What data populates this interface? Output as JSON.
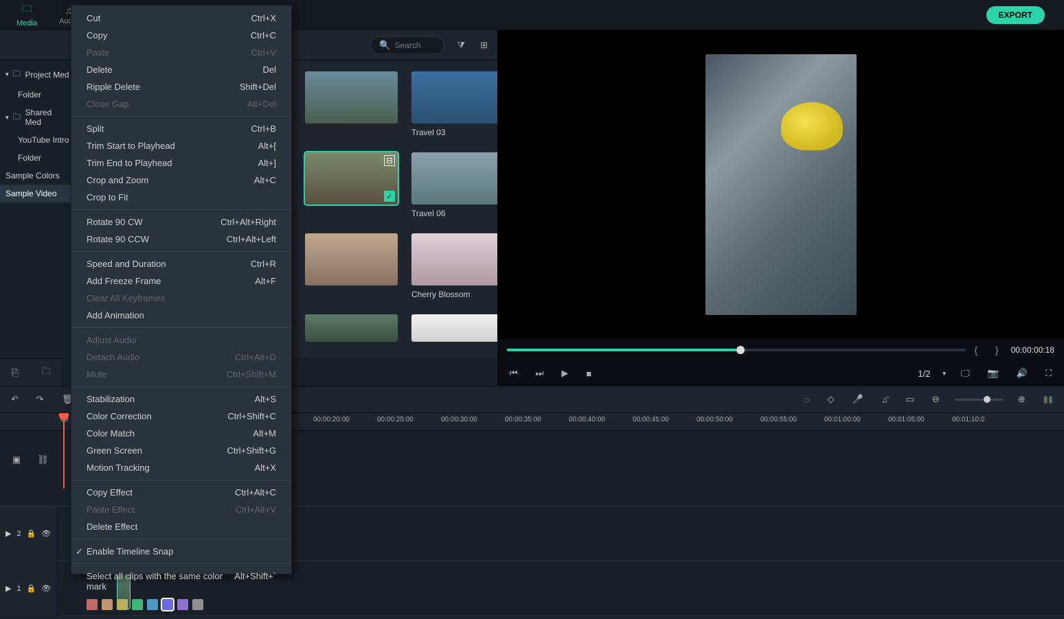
{
  "tabs": {
    "media": "Media",
    "audio": "Audio"
  },
  "export_label": "EXPORT",
  "search": {
    "placeholder": "Search"
  },
  "sidebar": {
    "project": "Project Med",
    "project_folder": "Folder",
    "shared": "Shared Med",
    "youtube": "YouTube Intro",
    "shared_folder": "Folder",
    "colors": "Sample Colors",
    "video": "Sample Video"
  },
  "thumbs": {
    "t3": "Travel 03",
    "t5_selected": true,
    "t6": "Travel 06",
    "blossom": "Cherry Blossom"
  },
  "preview": {
    "timecode": "00:00:00:18",
    "ratio": "1/2"
  },
  "ruler": [
    "00:00:20:00",
    "00:00:25:00",
    "00:00:30:00",
    "00:00:35:00",
    "00:00:40:00",
    "00:00:45:00",
    "00:00:50:00",
    "00:00:55:00",
    "00:01:00:00",
    "00:01:05:00",
    "00:01:10:0"
  ],
  "ruler_start": "00",
  "tracks": {
    "t2": "2",
    "t1": "1"
  },
  "ctx": {
    "cut": {
      "l": "Cut",
      "s": "Ctrl+X"
    },
    "copy": {
      "l": "Copy",
      "s": "Ctrl+C"
    },
    "paste": {
      "l": "Paste",
      "s": "Ctrl+V"
    },
    "delete": {
      "l": "Delete",
      "s": "Del"
    },
    "ripple": {
      "l": "Ripple Delete",
      "s": "Shift+Del"
    },
    "close_gap": {
      "l": "Close Gap",
      "s": "Alt+Del"
    },
    "split": {
      "l": "Split",
      "s": "Ctrl+B"
    },
    "trim_start": {
      "l": "Trim Start to Playhead",
      "s": "Alt+["
    },
    "trim_end": {
      "l": "Trim End to Playhead",
      "s": "Alt+]"
    },
    "crop_zoom": {
      "l": "Crop and Zoom",
      "s": "Alt+C"
    },
    "crop_fit": {
      "l": "Crop to Fit",
      "s": ""
    },
    "rot_cw": {
      "l": "Rotate 90 CW",
      "s": "Ctrl+Alt+Right"
    },
    "rot_ccw": {
      "l": "Rotate 90 CCW",
      "s": "Ctrl+Alt+Left"
    },
    "speed": {
      "l": "Speed and Duration",
      "s": "Ctrl+R"
    },
    "freeze": {
      "l": "Add Freeze Frame",
      "s": "Alt+F"
    },
    "clear_kf": {
      "l": "Clear All Keyframes",
      "s": ""
    },
    "add_anim": {
      "l": "Add Animation",
      "s": ""
    },
    "adj_audio": {
      "l": "Adjust Audio",
      "s": ""
    },
    "detach": {
      "l": "Detach Audio",
      "s": "Ctrl+Alt+D"
    },
    "mute": {
      "l": "Mute",
      "s": "Ctrl+Shift+M"
    },
    "stab": {
      "l": "Stabilization",
      "s": "Alt+S"
    },
    "color_corr": {
      "l": "Color Correction",
      "s": "Ctrl+Shift+C"
    },
    "color_match": {
      "l": "Color Match",
      "s": "Alt+M"
    },
    "green": {
      "l": "Green Screen",
      "s": "Ctrl+Shift+G"
    },
    "motion": {
      "l": "Motion Tracking",
      "s": "Alt+X"
    },
    "copy_fx": {
      "l": "Copy Effect",
      "s": "Ctrl+Alt+C"
    },
    "paste_fx": {
      "l": "Paste Effect",
      "s": "Ctrl+Alt+V"
    },
    "delete_fx": {
      "l": "Delete Effect",
      "s": ""
    },
    "snap": {
      "l": "Enable Timeline Snap",
      "s": ""
    },
    "select_color": {
      "l": "Select all clips with the same color mark",
      "s": "Alt+Shift+`"
    }
  },
  "swatches": [
    "#c46b6b",
    "#c4956b",
    "#b8b05a",
    "#3eb878",
    "#4a9ac4",
    "#6a6ae0",
    "#9070d0",
    "#909090"
  ],
  "swatch_selected": 5
}
